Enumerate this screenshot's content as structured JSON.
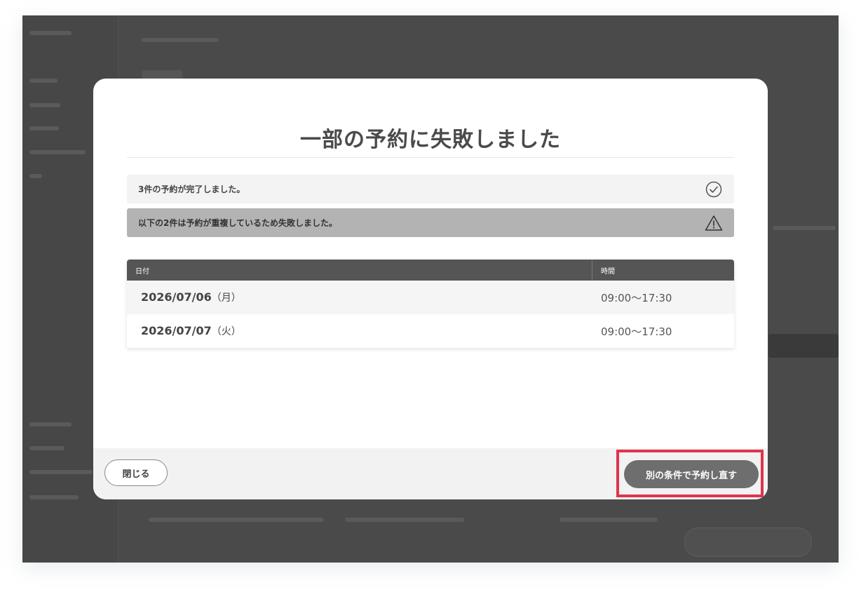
{
  "modal": {
    "title": "一部の予約に失敗しました",
    "success_notice": "3件の予約が完了しました。",
    "success_icon": "check-circle-icon",
    "fail_notice": "以下の2件は予約が重複しているため失敗しました。",
    "fail_icon": "warning-triangle-icon",
    "table": {
      "headers": {
        "date": "日付",
        "time": "時間"
      },
      "rows": [
        {
          "date": "2026/07/06",
          "weekday": "（月）",
          "time": "09:00〜17:30"
        },
        {
          "date": "2026/07/07",
          "weekday": "（火）",
          "time": "09:00〜17:30"
        }
      ]
    },
    "footer": {
      "close_label": "閉じる",
      "retry_label": "別の条件で予約し直す"
    }
  },
  "colors": {
    "overlay": "#4a4a4a",
    "header_bg": "#555555",
    "primary_button": "#6e6e6e",
    "highlight": "#e0344d",
    "fail_notice_bg": "#b3b3b3"
  }
}
